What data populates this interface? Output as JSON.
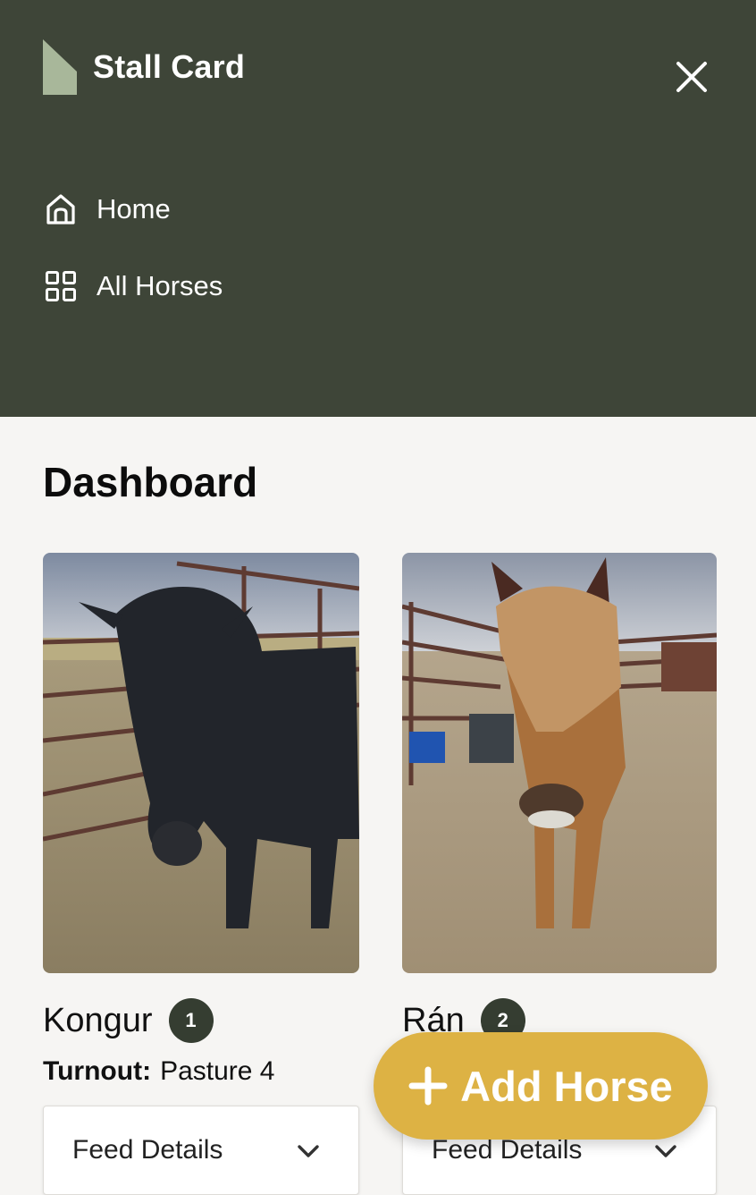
{
  "app": {
    "title": "Stall Card"
  },
  "nav": {
    "items": [
      {
        "label": "Home",
        "icon": "home-icon"
      },
      {
        "label": "All Horses",
        "icon": "grid-icon"
      }
    ],
    "close_icon": "close-icon"
  },
  "page": {
    "title": "Dashboard"
  },
  "horses": [
    {
      "name": "Kongur",
      "badge": "1",
      "turnout_label": "Turnout:",
      "turnout_value": "Pasture 4",
      "feed_label": "Feed Details"
    },
    {
      "name": "Rán",
      "badge": "2",
      "feed_label": "Feed Details"
    }
  ],
  "fab": {
    "label": "Add Horse",
    "icon": "plus-icon"
  },
  "colors": {
    "nav_bg": "#3e4538",
    "logo": "#a8b79a",
    "badge_bg": "#353d31",
    "fab_bg": "#ddb244",
    "page_bg": "#f6f5f3"
  }
}
